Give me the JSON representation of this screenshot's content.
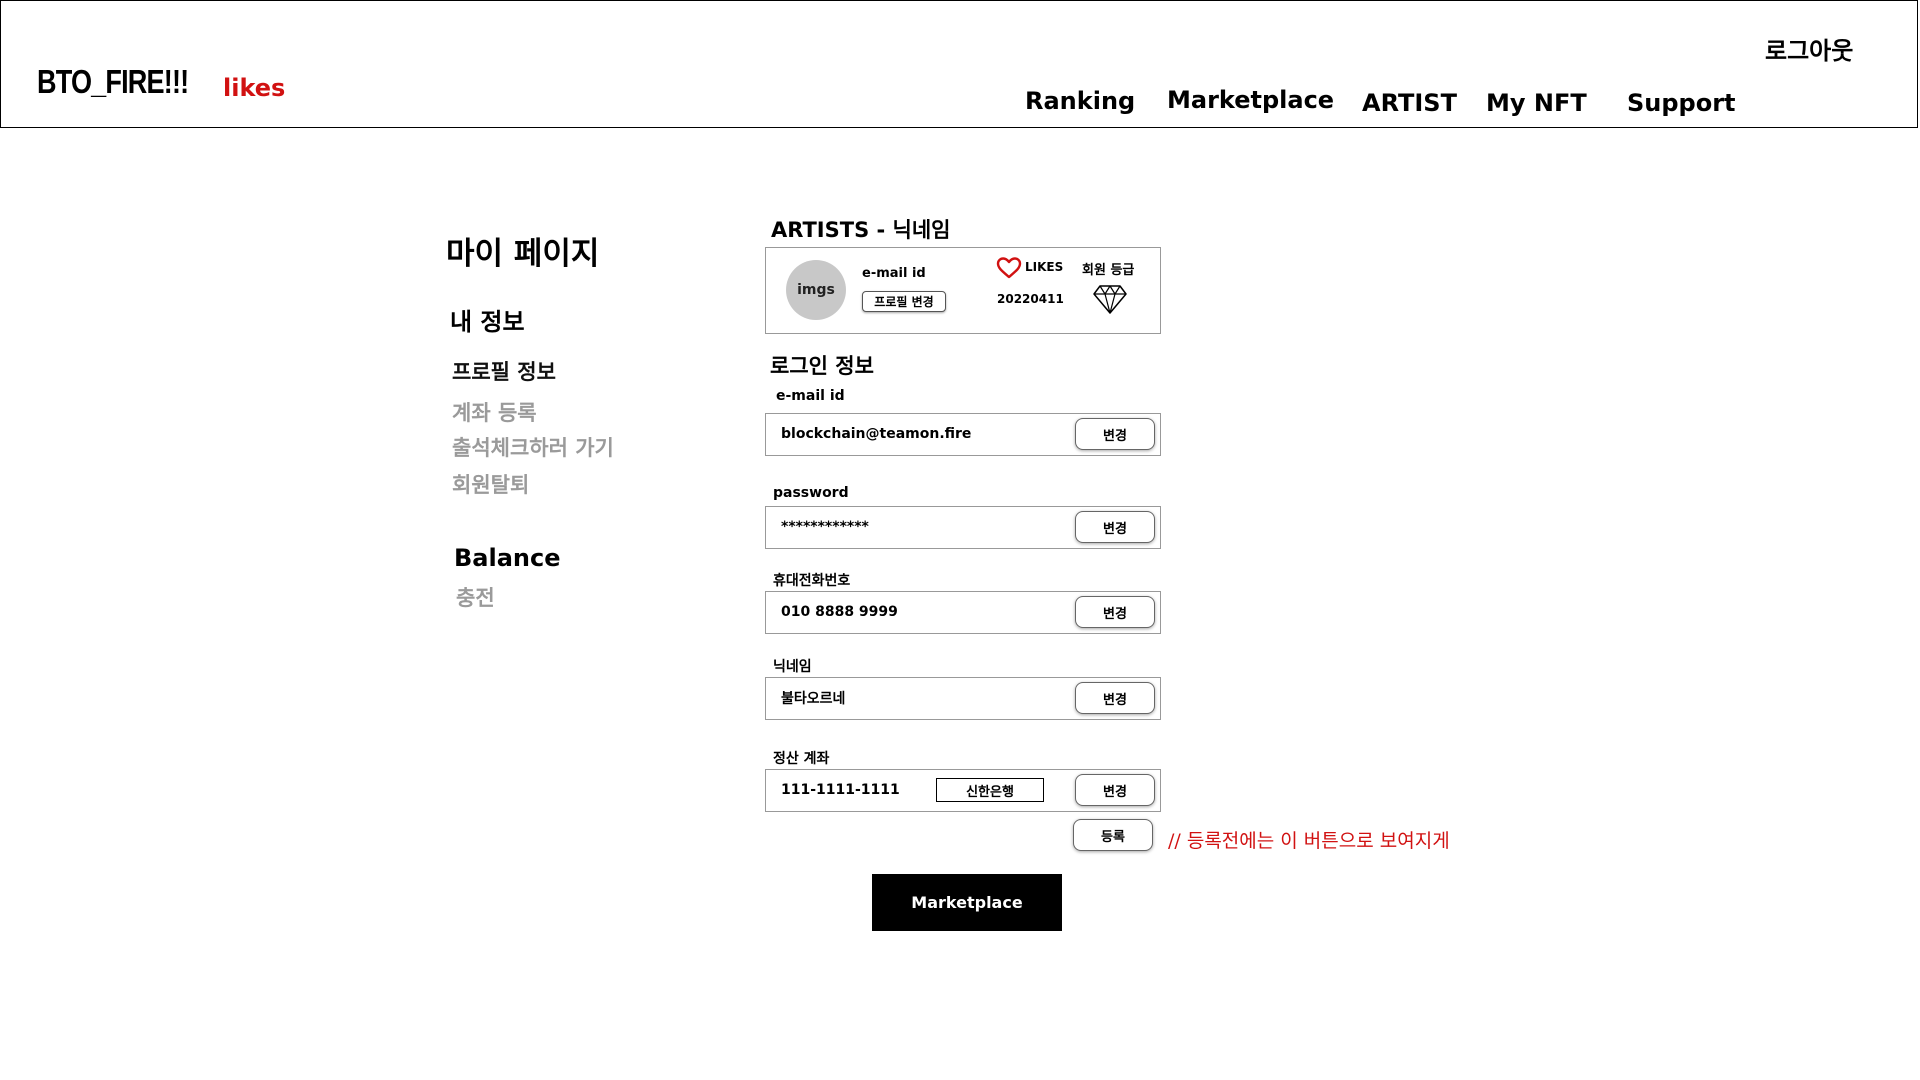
{
  "header": {
    "logo": "BTO_FIRE!!!",
    "tagline": "likes",
    "logout": "로그아웃",
    "nav": [
      "Ranking",
      "Marketplace",
      "ARTIST",
      "My NFT",
      "Support"
    ]
  },
  "sidebar": {
    "title": "마이 페이지",
    "section": "내 정보",
    "items": [
      {
        "label": "프로필 정보",
        "active": true
      },
      {
        "label": "계좌 등록",
        "active": false
      },
      {
        "label": "출석체크하러 가기",
        "active": false
      },
      {
        "label": "회원탈퇴",
        "active": false
      }
    ],
    "balance_title": "Balance",
    "balance_item": "충전"
  },
  "profile": {
    "title": "ARTISTS - 닉네임",
    "avatar": "imgs",
    "email_label": "e-mail id",
    "change_profile": "프로필 변경",
    "likes_label": "LIKES",
    "likes_value": "20220411",
    "grade_label": "회원 등급",
    "icons": {
      "heart": "heart-icon",
      "grade": "diamond-icon"
    },
    "colors": {
      "heart": "#d11111"
    }
  },
  "login": {
    "title": "로그인 정보",
    "change_label": "변경",
    "fields": [
      {
        "label": "e-mail id",
        "value": "blockchain@teamon.fire"
      },
      {
        "label": "password",
        "value": "************"
      },
      {
        "label": "휴대전화번호",
        "value": "010 8888 9999"
      },
      {
        "label": "닉네임",
        "value": "불타오르네"
      },
      {
        "label": "정산 계좌",
        "value": "111-1111-1111",
        "bank": "신한은행"
      }
    ],
    "register_label": "등록",
    "note": "// 등록전에는 이 버튼으로 보여지게"
  },
  "marketplace_button": "Marketplace",
  "colors": {
    "accent": "#d11111",
    "button_dark": "#000000"
  }
}
